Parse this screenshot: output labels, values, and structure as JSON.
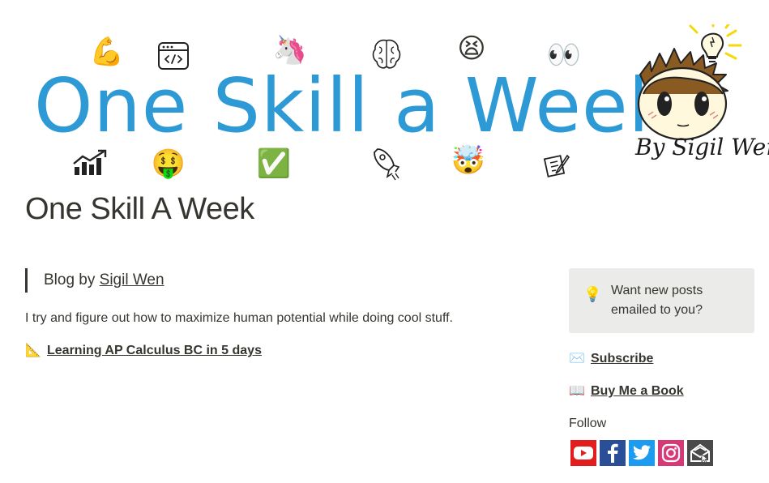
{
  "banner": {
    "title": "One Skill a Week",
    "byline": "By Sigil Wen",
    "emojis_top": [
      "💪",
      "🦄",
      "😫",
      "👀"
    ],
    "emojis_bottom": [
      "🤑",
      "✅",
      "🤯"
    ]
  },
  "page": {
    "title": "One Skill A Week"
  },
  "main": {
    "quote_prefix": "Blog by ",
    "quote_author": "Sigil Wen",
    "intro": "I try and figure out how to maximize human potential while doing cool stuff.",
    "post_icon": "📐",
    "post_link": "Learning AP Calculus BC in 5 days "
  },
  "sidebar": {
    "callout_icon": "💡",
    "callout_text": "Want new posts emailed to you?",
    "subscribe_icon": "✉️",
    "subscribe_label": "Subscribe",
    "book_icon": "📖",
    "book_label": "Buy Me a Book",
    "follow_label": "Follow",
    "socials": [
      "youtube-icon",
      "facebook-icon",
      "twitter-icon",
      "instagram-icon",
      "mail-icon"
    ]
  },
  "colors": {
    "banner_blue": "#2d9ad6",
    "text": "#37352f",
    "callout_bg": "#ebebea",
    "youtube": "#e21d1d",
    "facebook": "#2b4f96",
    "twitter": "#1c9bf0",
    "instagram": "#d63a76",
    "mail": "#4a4a4a"
  }
}
